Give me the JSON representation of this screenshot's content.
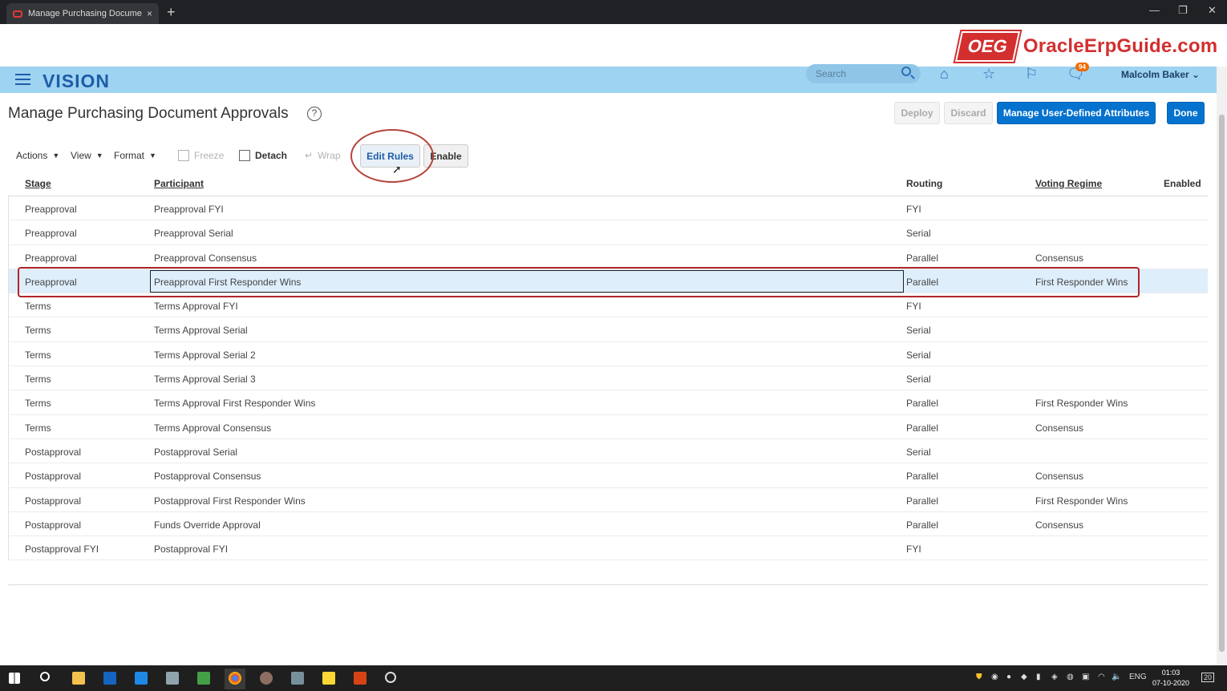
{
  "browser": {
    "tab_title": "Manage Purchasing Document A",
    "tab_close": "×",
    "new_tab": "+",
    "minimize": "—",
    "restore": "❐",
    "close": "✕"
  },
  "logo": {
    "badge": "OEG",
    "text": "OracleErpGuide.com"
  },
  "header": {
    "brand": "VISION",
    "search_placeholder": "Search",
    "notifications_count": "94",
    "user": "Malcolm Baker",
    "user_caret": "⌄"
  },
  "page": {
    "title": "Manage Purchasing Document Approvals",
    "help": "?",
    "buttons": {
      "deploy": "Deploy",
      "discard": "Discard",
      "manage_attrs": "Manage User-Defined Attributes",
      "done": "Done"
    }
  },
  "toolbar": {
    "actions": "Actions",
    "view": "View",
    "format": "Format",
    "freeze": "Freeze",
    "detach": "Detach",
    "wrap": "Wrap",
    "edit_rules": "Edit Rules",
    "enable": "Enable",
    "caret": "▼"
  },
  "table": {
    "headers": {
      "stage": "Stage",
      "participant": "Participant",
      "routing": "Routing",
      "voting": "Voting Regime",
      "enabled": "Enabled"
    },
    "rows": [
      {
        "stage": "Preapproval",
        "participant": "Preapproval FYI",
        "routing": "FYI",
        "voting": ""
      },
      {
        "stage": "Preapproval",
        "participant": "Preapproval Serial",
        "routing": "Serial",
        "voting": ""
      },
      {
        "stage": "Preapproval",
        "participant": "Preapproval Consensus",
        "routing": "Parallel",
        "voting": "Consensus"
      },
      {
        "stage": "Preapproval",
        "participant": "Preapproval First Responder Wins",
        "routing": "Parallel",
        "voting": "First Responder Wins"
      },
      {
        "stage": "Terms",
        "participant": "Terms Approval FYI",
        "routing": "FYI",
        "voting": ""
      },
      {
        "stage": "Terms",
        "participant": "Terms Approval Serial",
        "routing": "Serial",
        "voting": ""
      },
      {
        "stage": "Terms",
        "participant": "Terms Approval Serial 2",
        "routing": "Serial",
        "voting": ""
      },
      {
        "stage": "Terms",
        "participant": "Terms Approval Serial 3",
        "routing": "Serial",
        "voting": ""
      },
      {
        "stage": "Terms",
        "participant": "Terms Approval First Responder Wins",
        "routing": "Parallel",
        "voting": "First Responder Wins"
      },
      {
        "stage": "Terms",
        "participant": "Terms Approval Consensus",
        "routing": "Parallel",
        "voting": "Consensus"
      },
      {
        "stage": "Postapproval",
        "participant": "Postapproval Serial",
        "routing": "Serial",
        "voting": ""
      },
      {
        "stage": "Postapproval",
        "participant": "Postapproval Consensus",
        "routing": "Parallel",
        "voting": "Consensus"
      },
      {
        "stage": "Postapproval",
        "participant": "Postapproval First Responder Wins",
        "routing": "Parallel",
        "voting": "First Responder Wins"
      },
      {
        "stage": "Postapproval",
        "participant": "Funds Override Approval",
        "routing": "Parallel",
        "voting": "Consensus"
      },
      {
        "stage": "Postapproval FYI",
        "participant": "Postapproval FYI",
        "routing": "FYI",
        "voting": ""
      }
    ]
  },
  "taskbar": {
    "lang": "ENG",
    "time": "01:03",
    "date": "07-10-2020",
    "notif": "20"
  }
}
